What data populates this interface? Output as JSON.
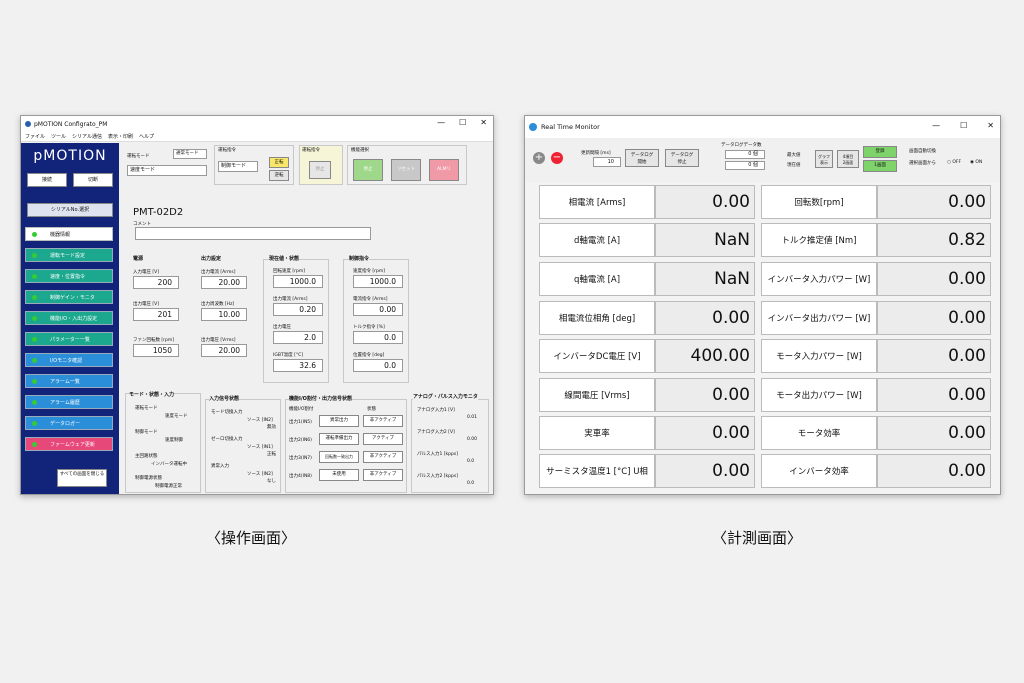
{
  "left_window": {
    "title": "pMOTION Configrato_PM",
    "menu": [
      "ファイル",
      "ツール",
      "シリアル通信",
      "表示・印刷",
      "ヘルプ"
    ],
    "logo": "pMOTION",
    "connect": "接続",
    "disconnect": "切断",
    "serial_select": "シリアルNo.選択",
    "nav": [
      "機器情報",
      "運転モード設定",
      "速度・位置指令",
      "制御ゲイン・モニタ",
      "機能I/O・入出力設定",
      "パラメーター一覧",
      "I/Oモニタ確認",
      "アラーム一覧",
      "アラーム履歴",
      "データロガー",
      "ファームウェア更新"
    ],
    "close_all": "すべての画面を閉じる",
    "run_mode_label": "運転モード",
    "run_mode_value": "速度モード",
    "run_mode_sub": "通常モード",
    "run_cmd_label": "運転指令",
    "run_cmd_value": "制御モード",
    "forward": "正転",
    "reverse": "逆転",
    "run_order_label": "運転指令",
    "stop": "停止",
    "func_select_label": "機能選択",
    "func_btn1": "停止",
    "func_btn2": "リセット",
    "func_btn3": "ALMリ",
    "model": "PMT-02D2",
    "comment_label": "コメント",
    "power": {
      "title": "電源",
      "vin_label": "入力電圧 [V]",
      "vin": "200",
      "vout_label": "出力電圧 [V]",
      "vout": "201",
      "fan_label": "ファン回転数 [rpm]",
      "fan": "1050"
    },
    "output": {
      "title": "出力設定",
      "i_label": "出力電流 [Arms]",
      "i": "20.00",
      "f_label": "出力周波数 [Hz]",
      "f": "10.00",
      "v_label": "出力電圧 [Vrms]",
      "v": "20.00"
    },
    "current": {
      "title": "現在値・状態",
      "speed_label": "回転速度 [rpm]",
      "speed": "1000.0",
      "cur_label": "出力電流 [Arms]",
      "cur": "0.20",
      "volt_label": "出力電圧",
      "volt": "2.0",
      "igbt_label": "IGBT温度 [°C]",
      "igbt": "32.6"
    },
    "control": {
      "title": "制御指令",
      "speed_label": "速度指令 [rpm]",
      "speed": "1000.0",
      "cur_label": "電流指令 [Arms]",
      "cur": "0.00",
      "torque_label": "トルク指令 [%]",
      "torque": "0.0",
      "pos_label": "位置指令 [deg]",
      "pos": "0.0"
    },
    "mode_state": {
      "title": "モード・状態・入力",
      "rows": [
        [
          "運転モード",
          "速度モード"
        ],
        [
          "制御モード",
          "速度制御"
        ],
        [
          "主回路状態",
          "インバータ運転中"
        ],
        [
          "制御電源状態",
          "制御電源正常"
        ]
      ]
    },
    "input_sig": {
      "title": "入力信号状態",
      "rows": [
        [
          "モード切換入力",
          "ソース [IN2]",
          "無効"
        ],
        [
          "ゼーロ切換入力",
          "ソース [IN1]",
          "正転"
        ],
        [
          "異常入力",
          "ソース [IN2]",
          "なし"
        ]
      ]
    },
    "func_io": {
      "title": "機能I/O割付・出力信号状態",
      "sub1": "機能I/O割付",
      "sub2": "状態",
      "rows": [
        [
          "出力1(IN5)",
          "異常出力",
          "非アクティブ"
        ],
        [
          "出力2(IN6)",
          "運転準備出力",
          "アクティブ"
        ],
        [
          "出力3(IN7)",
          "回転数一致出力",
          "非アクティブ"
        ],
        [
          "出力4(IN8)",
          "未使用",
          "非アクティブ"
        ]
      ]
    },
    "analog": {
      "title": "アナログ・パルス入力モニタ",
      "rows": [
        [
          "アナログ入力1 [V]",
          "0.01"
        ],
        [
          "アナログ入力2 [V]",
          "0.00"
        ],
        [
          "パルス入力1 [kpps]",
          "0.0"
        ],
        [
          "パルス入力2 [kpps]",
          "0.0"
        ]
      ]
    }
  },
  "right_window": {
    "title": "Real Time Monitor",
    "interval_label": "更新間隔 [ms]",
    "interval": "10",
    "log_start": "データログ\n開始",
    "log_stop": "データログ\n停止",
    "log_count_label": "データログデータ数",
    "log_count1": "0 個",
    "log_count2": "0 個",
    "max_label": "最大値",
    "cur_label": "現在値",
    "graph_btn": "グラフ\n表示",
    "x2_btn": "4項目\n2画面",
    "reg_btn": "登録",
    "item_btn": "1画面",
    "auto_switch_label": "画面自動切換",
    "auto_switch_sub": "選択画面から",
    "off": "OFF",
    "on": "ON",
    "metrics": [
      {
        "label": "相電流 [Arms]",
        "value": "0.00"
      },
      {
        "label": "d軸電流 [A]",
        "value": "NaN"
      },
      {
        "label": "q軸電流 [A]",
        "value": "NaN"
      },
      {
        "label": "相電流位相角 [deg]",
        "value": "0.00"
      },
      {
        "label": "インバータDC電圧 [V]",
        "value": "400.00"
      },
      {
        "label": "線間電圧 [Vrms]",
        "value": "0.00"
      },
      {
        "label": "実車率",
        "value": "0.00"
      },
      {
        "label": "サーミスタ温度1 [°C] U相",
        "value": "0.00"
      }
    ],
    "metrics2": [
      {
        "label": "回転数[rpm]",
        "value": "0.00"
      },
      {
        "label": "トルク推定値 [Nm]",
        "value": "0.82"
      },
      {
        "label": "インバータ入力パワー [W]",
        "value": "0.00"
      },
      {
        "label": "インバータ出力パワー [W]",
        "value": "0.00"
      },
      {
        "label": "モータ入力パワー [W]",
        "value": "0.00"
      },
      {
        "label": "モータ出力パワー [W]",
        "value": "0.00"
      },
      {
        "label": "モータ効率",
        "value": "0.00"
      },
      {
        "label": "インバータ効率",
        "value": "0.00"
      }
    ]
  },
  "captions": {
    "left": "〈操作画面〉",
    "right": "〈計測画面〉"
  }
}
